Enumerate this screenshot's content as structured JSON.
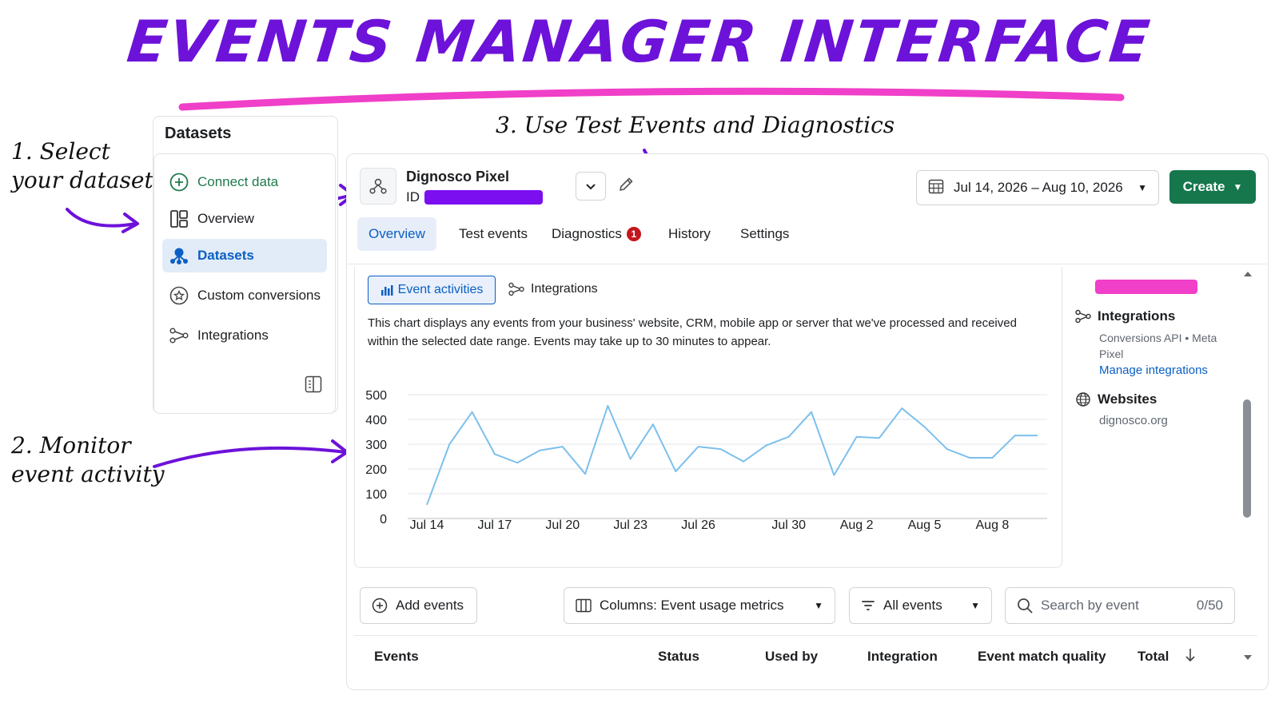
{
  "hero": {
    "title": "EVENTS MANAGER INTERFACE"
  },
  "notes": {
    "note1_line1": "1. Select",
    "note1_line2": "your dataset",
    "note2_line1": "2. Monitor",
    "note2_line2": "event activity",
    "note3": "3. Use Test Events and Diagnostics"
  },
  "colors": {
    "title_purple": "#6d12d9",
    "underline_pink": "#f03fc8",
    "arrow_purple": "#6d12d9",
    "create_green": "#16774d",
    "active_blue": "#0a5fc4",
    "redaction": "#7c0ff0"
  },
  "sidebar": {
    "title": "Datasets",
    "items": [
      {
        "label": "Connect data",
        "icon": "plus-circle-icon"
      },
      {
        "label": "Overview",
        "icon": "layout-icon"
      },
      {
        "label": "Datasets",
        "icon": "datasets-icon",
        "active": true
      },
      {
        "label": "Custom conversions",
        "icon": "star-circle-icon"
      },
      {
        "label": "Integrations",
        "icon": "integrations-icon"
      }
    ]
  },
  "header": {
    "pixel_name": "Dignosco Pixel",
    "id_label": "ID",
    "date_range": "Jul 14, 2026 – Aug 10, 2026",
    "create_label": "Create"
  },
  "tabs": [
    {
      "label": "Overview",
      "active": true
    },
    {
      "label": "Test events"
    },
    {
      "label": "Diagnostics",
      "badge": "1"
    },
    {
      "label": "History"
    },
    {
      "label": "Settings"
    }
  ],
  "subtabs": {
    "event_activities": "Event activities",
    "integrations": "Integrations"
  },
  "chart_desc": {
    "line1": "This chart displays any events from your business' website, CRM, mobile app or server that we've processed and received",
    "line2": "within the selected date range. Events may take up to 30 minutes to appear."
  },
  "chart_data": {
    "type": "line",
    "x": [
      "Jul 14",
      "Jul 15",
      "Jul 16",
      "Jul 17",
      "Jul 18",
      "Jul 19",
      "Jul 20",
      "Jul 21",
      "Jul 22",
      "Jul 23",
      "Jul 24",
      "Jul 25",
      "Jul 26",
      "Jul 27",
      "Jul 28",
      "Jul 29",
      "Jul 30",
      "Jul 31",
      "Aug 1",
      "Aug 2",
      "Aug 3",
      "Aug 4",
      "Aug 5",
      "Aug 6",
      "Aug 7",
      "Aug 8",
      "Aug 9",
      "Aug 10"
    ],
    "x_tick_labels": [
      "Jul 14",
      "Jul 17",
      "Jul 20",
      "Jul 23",
      "Jul 26",
      "Jul 30",
      "Aug 2",
      "Aug 5",
      "Aug 8"
    ],
    "series": [
      {
        "values": [
          55,
          300,
          430,
          260,
          225,
          275,
          290,
          180,
          455,
          240,
          380,
          190,
          290,
          280,
          230,
          295,
          330,
          430,
          175,
          330,
          325,
          445,
          370,
          280,
          245,
          245,
          335,
          335
        ]
      }
    ],
    "ylim": [
      0,
      500
    ],
    "y_ticks": [
      0,
      100,
      200,
      300,
      400,
      500
    ],
    "grid": true,
    "line_color": "#7cc0ec"
  },
  "right_panel": {
    "integrations_title": "Integrations",
    "integrations_sub": "Conversions API • Meta Pixel",
    "manage_link": "Manage integrations",
    "websites_title": "Websites",
    "website": "dignosco.org"
  },
  "toolbar": {
    "add_events": "Add events",
    "columns": "Columns: Event usage metrics",
    "filter": "All events",
    "search_placeholder": "Search by event",
    "search_count": "0/50"
  },
  "table": {
    "headers": [
      "Events",
      "Status",
      "Used by",
      "Integration",
      "Event match quality",
      "Total"
    ]
  }
}
